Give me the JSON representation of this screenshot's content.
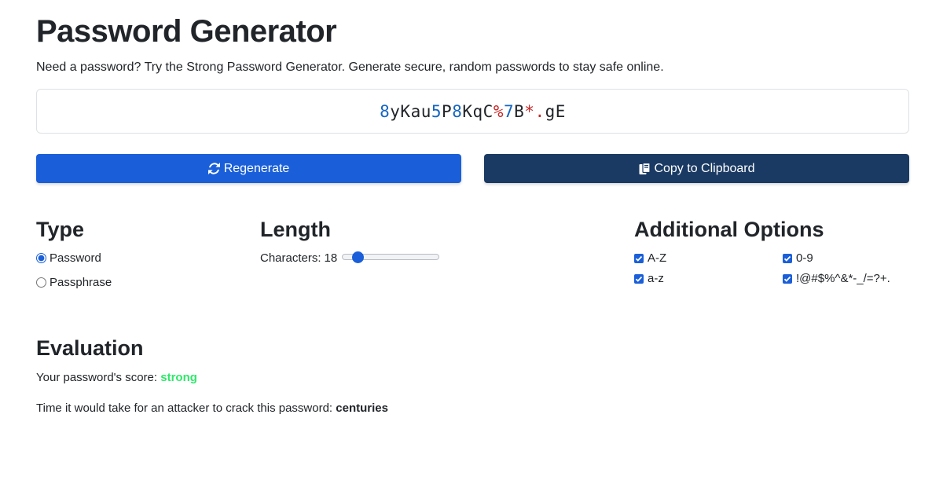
{
  "header": {
    "title": "Password Generator",
    "subtitle": "Need a password? Try the Strong Password Generator. Generate secure, random passwords to stay safe online."
  },
  "password": {
    "value": "8yKau5P8KqC%7B*.gE",
    "digit_color": "#1565c0",
    "symbol_color": "#c62828",
    "letter_color": "#212529"
  },
  "buttons": {
    "regenerate_label": "Regenerate",
    "regenerate_icon": "refresh-icon",
    "regenerate_color": "#1a5fd9",
    "copy_label": "Copy to Clipboard",
    "copy_icon": "clipboard-icon",
    "copy_color": "#1a3a63"
  },
  "type_section": {
    "heading": "Type",
    "options": [
      {
        "label": "Password",
        "selected": true
      },
      {
        "label": "Passphrase",
        "selected": false
      }
    ]
  },
  "length_section": {
    "heading": "Length",
    "characters_label": "Characters:",
    "characters_value": "18",
    "slider_level": 0.12
  },
  "options_section": {
    "heading": "Additional Options",
    "options": [
      {
        "label": "A-Z",
        "checked": true
      },
      {
        "label": "0-9",
        "checked": true
      },
      {
        "label": "a-z",
        "checked": true
      },
      {
        "label": "!@#$%^&*-_/=?+.",
        "checked": true
      }
    ]
  },
  "evaluation": {
    "heading": "Evaluation",
    "score_label": "Your password's score:",
    "score_value": "strong",
    "score_color": "#2ee86a",
    "crack_label": "Time it would take for an attacker to crack this password:",
    "crack_value": "centuries"
  }
}
